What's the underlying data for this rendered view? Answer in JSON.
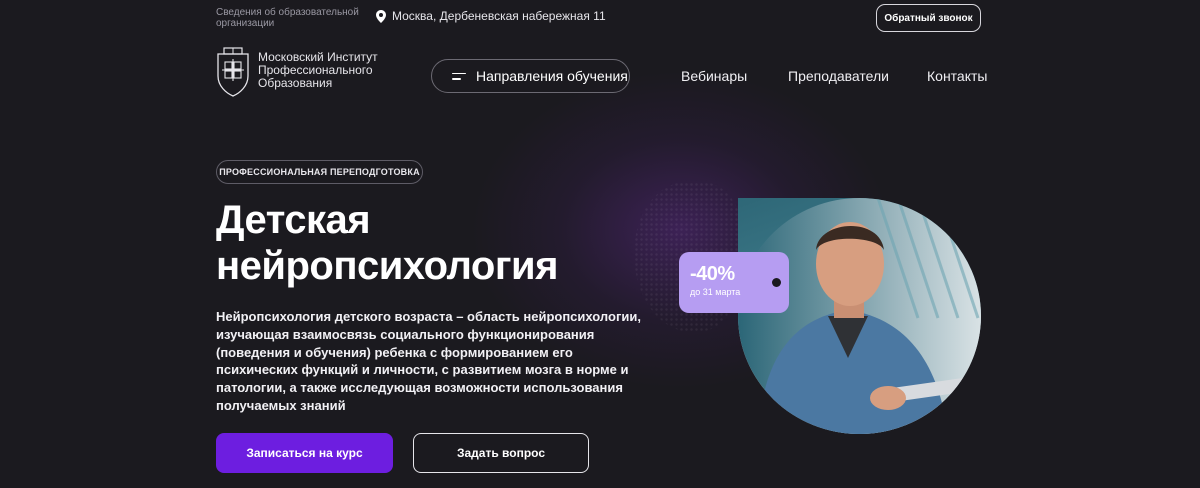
{
  "topbar": {
    "org_info": "Сведения об образовательной организации",
    "address": "Москва, Дербеневская набережная 11",
    "callback_label": "Обратный звонок"
  },
  "logo": {
    "line1": "Московский Институт",
    "line2": "Профессионального",
    "line3": "Образования"
  },
  "nav": {
    "directions_label": "Направления обучения",
    "items": [
      {
        "label": "Вебинары"
      },
      {
        "label": "Преподаватели"
      },
      {
        "label": "Контакты"
      }
    ]
  },
  "hero": {
    "tag": "ПРОФЕССИОНАЛЬНАЯ ПЕРЕПОДГОТОВКА",
    "title_line1": "Детская",
    "title_line2": "нейропсихология",
    "description": "Нейропсихология детского возраста – область нейропсихологии, изучающая взаимосвязь социального функционирования (поведения и обучения) ребенка с формированием его психических функций и личности, с развитием мозга в норме и патологии, а также исследующая возможности использования получаемых знаний",
    "primary_button": "Записаться на курс",
    "secondary_button": "Задать вопрос"
  },
  "discount": {
    "value": "-40%",
    "note": "до 31 марта"
  },
  "colors": {
    "background": "#1b1a1f",
    "accent": "#6d1ee0",
    "discount": "#b69df2"
  },
  "icons": [
    "map-pin-icon",
    "menu-icon",
    "logo-emblem-icon"
  ]
}
